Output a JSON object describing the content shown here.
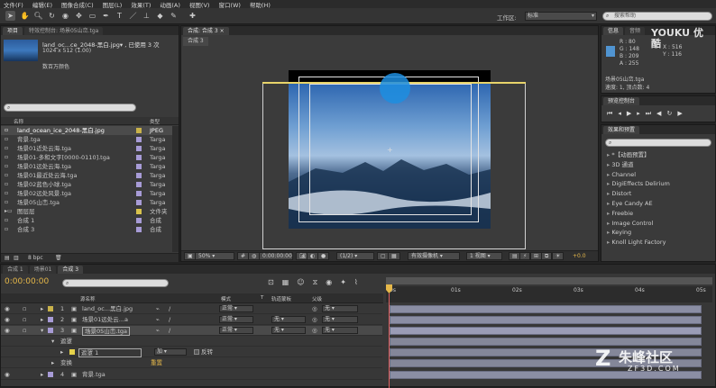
{
  "menu": [
    "文件(F)",
    "编辑(E)",
    "图像合成(C)",
    "图层(L)",
    "效果(T)",
    "动画(A)",
    "视图(V)",
    "窗口(W)",
    "帮助(H)"
  ],
  "toolbar": {
    "workspace_label": "工作区:",
    "workspace_value": "标准",
    "help_placeholder": "搜索帮助"
  },
  "project": {
    "tabs": [
      "项目",
      "特效控制台: 场景05山峦.tga"
    ],
    "file_name": "land_oc...ce_2048-黑白.jpg▾ , 已使用 3 次",
    "file_dims": "1024 x 512 (1.00)",
    "file_colors": "数百万颜色",
    "col_name": "名称",
    "col_type": "类型",
    "items": [
      {
        "name": "land_ocean_ice_2048-黑白.jpg",
        "type": "JPEG",
        "color": "#c9b24a"
      },
      {
        "name": "背景.tga",
        "type": "Targa",
        "color": "#a79bd6"
      },
      {
        "name": "场景01近处云海.tga",
        "type": "Targa",
        "color": "#a79bd6"
      },
      {
        "name": "场景01-多和文字[0000-0110].tga",
        "type": "Targa",
        "color": "#a79bd6"
      },
      {
        "name": "场景01远处云海.tga",
        "type": "Targa",
        "color": "#a79bd6"
      },
      {
        "name": "场景01最近处云海.tga",
        "type": "Targa",
        "color": "#a79bd6"
      },
      {
        "name": "场景02蓝色小球.tga",
        "type": "Targa",
        "color": "#a79bd6"
      },
      {
        "name": "场景02远处风景.tga",
        "type": "Targa",
        "color": "#a79bd6"
      },
      {
        "name": "场景05山峦.tga",
        "type": "Targa",
        "color": "#a79bd6"
      },
      {
        "name": "图层层",
        "type": "文件夹",
        "color": "#d8c24c"
      },
      {
        "name": "合成 1",
        "type": "合成",
        "color": "#a79bd6"
      },
      {
        "name": "合成 3",
        "type": "合成",
        "color": "#a79bd6"
      }
    ],
    "bpc": "8 bpc"
  },
  "comp": {
    "tab": "合成: 合成 3",
    "subtab": "合成 3",
    "zoom": "50%",
    "time": "0:00:00:00",
    "res": "(1/2)",
    "camera": "有效摄像机",
    "views": "1 视图",
    "offset": "+0.0"
  },
  "info": {
    "tabs": [
      "信息",
      "音频"
    ],
    "r": "R : 80",
    "g": "G : 148",
    "b": "B : 209",
    "a": "A : 255",
    "x": "X : 516",
    "y": "Y : 116",
    "swatch": "#5094d1",
    "file": "场景05山峦.tga",
    "detail": "速度: 1, 顶点数: 4"
  },
  "preview": {
    "tab": "预览控制台"
  },
  "effects": {
    "tab": "效果和预置",
    "items": [
      "*【动画预置】",
      "3D 通道",
      "Channel",
      "DigiEffects Delirium",
      "Distort",
      "Eye Candy AE",
      "Freebie",
      "Image Control",
      "Keying",
      "Knoll Light Factory"
    ]
  },
  "timeline": {
    "tabs": [
      "合成 1",
      "场景01",
      "合成 3"
    ],
    "time": "0:00:00:00",
    "col_source": "源名称",
    "col_mode": "模式",
    "col_t": "T",
    "col_trkmat": "轨道蒙板",
    "col_parent": "父级",
    "ruler": [
      "0s",
      "01s",
      "02s",
      "03s",
      "04s",
      "05s"
    ],
    "layers": [
      {
        "num": "1",
        "name": "land_oc...黑白.jpg",
        "mode": "正常",
        "trk": "",
        "parent": "无"
      },
      {
        "num": "2",
        "name": "场景01远处云...a",
        "mode": "正常",
        "trk": "无",
        "parent": "无"
      },
      {
        "num": "3",
        "name": "场景05山峦.tga",
        "mode": "正常",
        "trk": "无",
        "parent": "无"
      }
    ],
    "mask_group": "遮罩",
    "mask_name": "遮罩 1",
    "mask_mode": "加",
    "mask_invert": "反转",
    "transform": "变换",
    "transform_reset": "重置",
    "layer4_num": "4",
    "layer4_name": "背景.tga"
  },
  "watermarks": {
    "youku": "YOUKU 优酷",
    "brand": "朱峰社区",
    "brand_url": "ZF3D.COM"
  }
}
